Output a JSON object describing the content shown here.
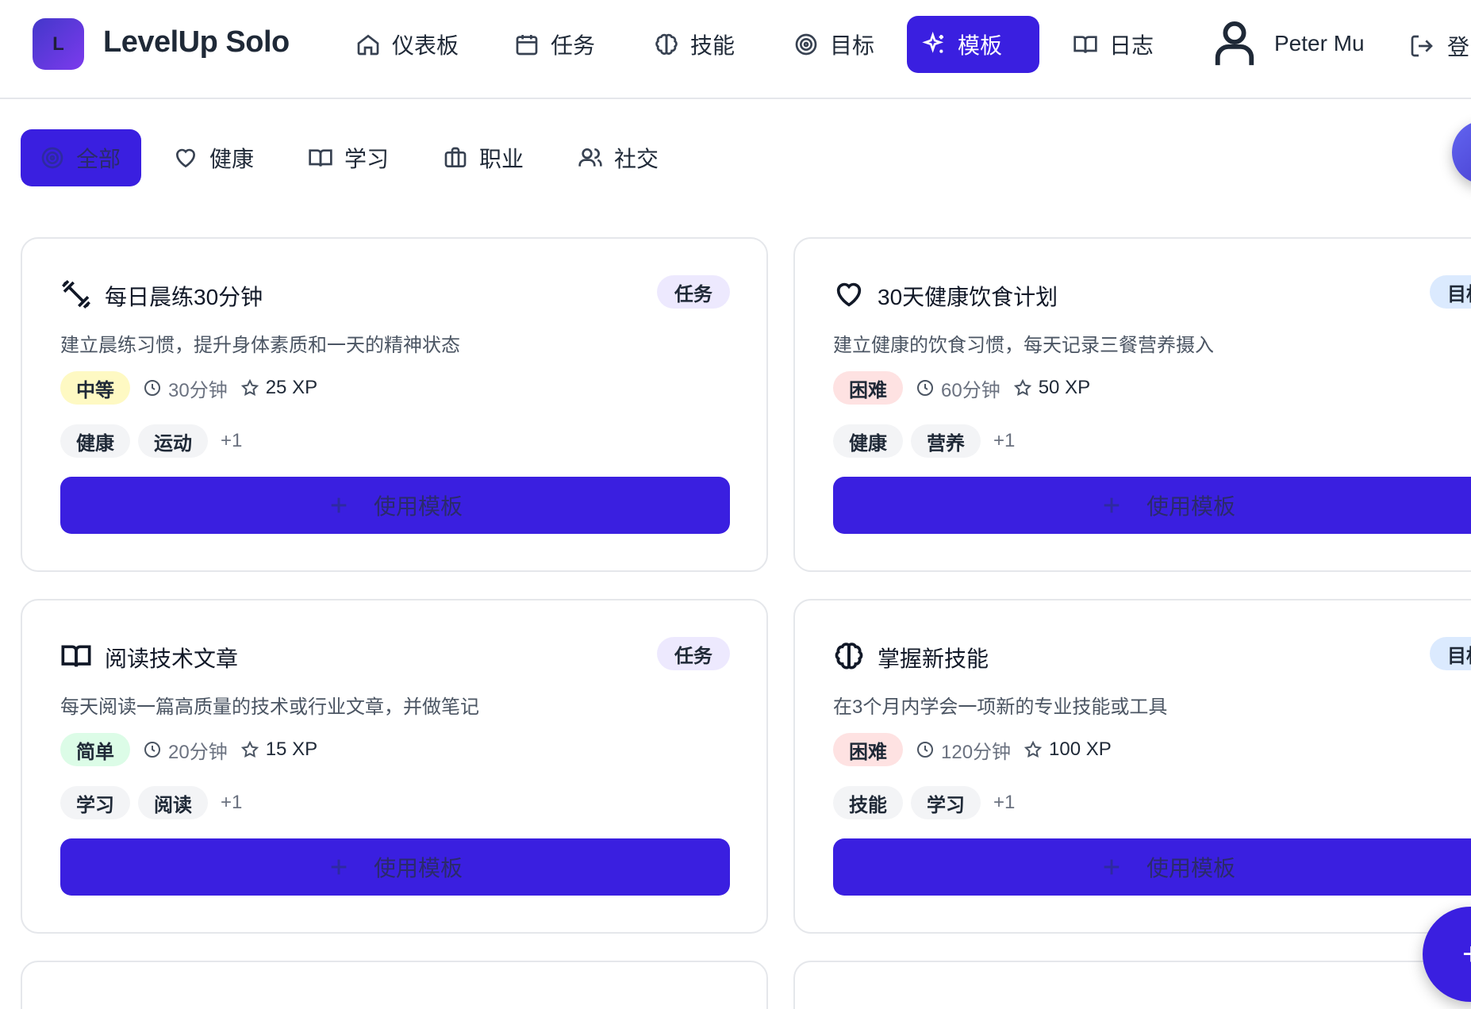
{
  "header": {
    "logo_letter": "L",
    "brand": "LevelUp Solo",
    "nav": [
      {
        "label": "仪表板",
        "icon": "home-icon"
      },
      {
        "label": "任务",
        "icon": "calendar-icon"
      },
      {
        "label": "技能",
        "icon": "brain-icon"
      },
      {
        "label": "目标",
        "icon": "target-icon"
      },
      {
        "label": "模板",
        "icon": "sparkles-icon",
        "active": true
      },
      {
        "label": "日志",
        "icon": "book-icon"
      }
    ],
    "user_name": "Peter Mu",
    "logout_label": "登"
  },
  "filters": [
    {
      "label": "全部",
      "icon": "target-icon",
      "active": true
    },
    {
      "label": "健康",
      "icon": "heart-icon"
    },
    {
      "label": "学习",
      "icon": "book-icon"
    },
    {
      "label": "职业",
      "icon": "briefcase-icon"
    },
    {
      "label": "社交",
      "icon": "users-icon"
    }
  ],
  "cards": [
    {
      "icon": "dumbbell-icon",
      "title": "每日晨练30分钟",
      "type": "任务",
      "description": "建立晨练习惯，提升身体素质和一天的精神状态",
      "difficulty": "中等",
      "duration": "30分钟",
      "xp": "25 XP",
      "tags": [
        "健康",
        "运动"
      ],
      "more": "+1",
      "button": "使用模板"
    },
    {
      "icon": "heart-icon",
      "title": "30天健康饮食计划",
      "type": "目标",
      "description": "建立健康的饮食习惯，每天记录三餐营养摄入",
      "difficulty": "困难",
      "duration": "60分钟",
      "xp": "50 XP",
      "tags": [
        "健康",
        "营养"
      ],
      "more": "+1",
      "button": "使用模板"
    },
    {
      "icon": "book-icon",
      "title": "阅读技术文章",
      "type": "任务",
      "description": "每天阅读一篇高质量的技术或行业文章，并做笔记",
      "difficulty": "简单",
      "duration": "20分钟",
      "xp": "15 XP",
      "tags": [
        "学习",
        "阅读"
      ],
      "more": "+1",
      "button": "使用模板"
    },
    {
      "icon": "brain-icon",
      "title": "掌握新技能",
      "type": "目标",
      "description": "在3个月内学会一项新的专业技能或工具",
      "difficulty": "困难",
      "duration": "120分钟",
      "xp": "100 XP",
      "tags": [
        "技能",
        "学习"
      ],
      "more": "+1",
      "button": "使用模板"
    }
  ],
  "fab_label": "+"
}
